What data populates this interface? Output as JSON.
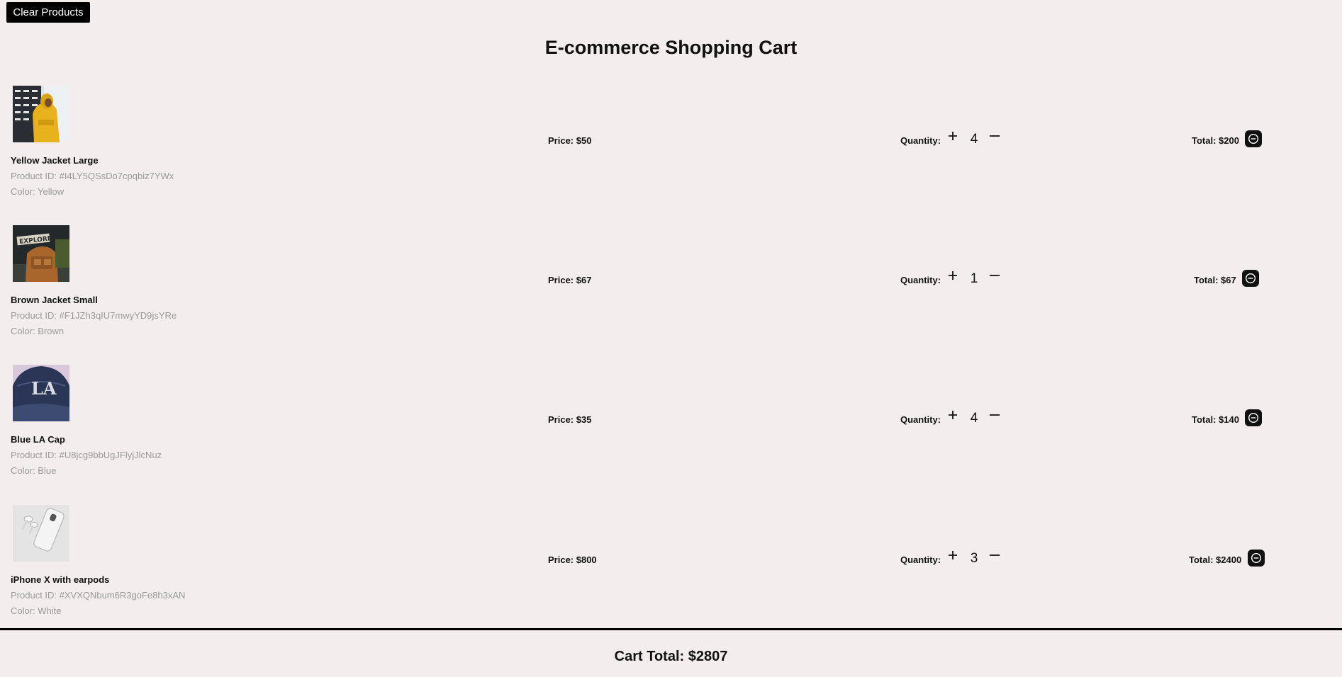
{
  "header": {
    "clear_button_label": "Clear Products",
    "title": "E-commerce Shopping Cart"
  },
  "items": [
    {
      "image_icon": "yellow-jacket-photo",
      "name": "Yellow Jacket Large",
      "product_id": "Product ID: #I4LY5QSsDo7cpqbiz7YWx",
      "color": "Color: Yellow",
      "price": "Price: $50",
      "quantity_label": "Quantity:",
      "quantity": "4",
      "total": "Total: $200"
    },
    {
      "image_icon": "brown-jacket-photo",
      "name": "Brown Jacket Small",
      "product_id": "Product ID: #F1JZh3qIU7mwyYD9jsYRe",
      "color": "Color: Brown",
      "price": "Price: $67",
      "quantity_label": "Quantity:",
      "quantity": "1",
      "total": "Total: $67"
    },
    {
      "image_icon": "blue-cap-photo",
      "name": "Blue LA Cap",
      "product_id": "Product ID: #U8jcg9bbUgJFlyjJlcNuz",
      "color": "Color: Blue",
      "price": "Price: $35",
      "quantity_label": "Quantity:",
      "quantity": "4",
      "total": "Total: $140"
    },
    {
      "image_icon": "iphone-earpods-photo",
      "name": "iPhone X with earpods",
      "product_id": "Product ID: #XVXQNbum6R3goFe8h3xAN",
      "color": "Color: White",
      "price": "Price: $800",
      "quantity_label": "Quantity:",
      "quantity": "3",
      "total": "Total: $2400"
    }
  ],
  "footer": {
    "cart_total": "Cart Total: $2807"
  },
  "icons": {
    "increment": "plus-icon",
    "decrement": "minus-icon",
    "remove": "minus-circle-icon"
  },
  "colors": {
    "background": "#f3eded",
    "button_bg": "#000000",
    "muted_text": "#9a9a9a"
  }
}
